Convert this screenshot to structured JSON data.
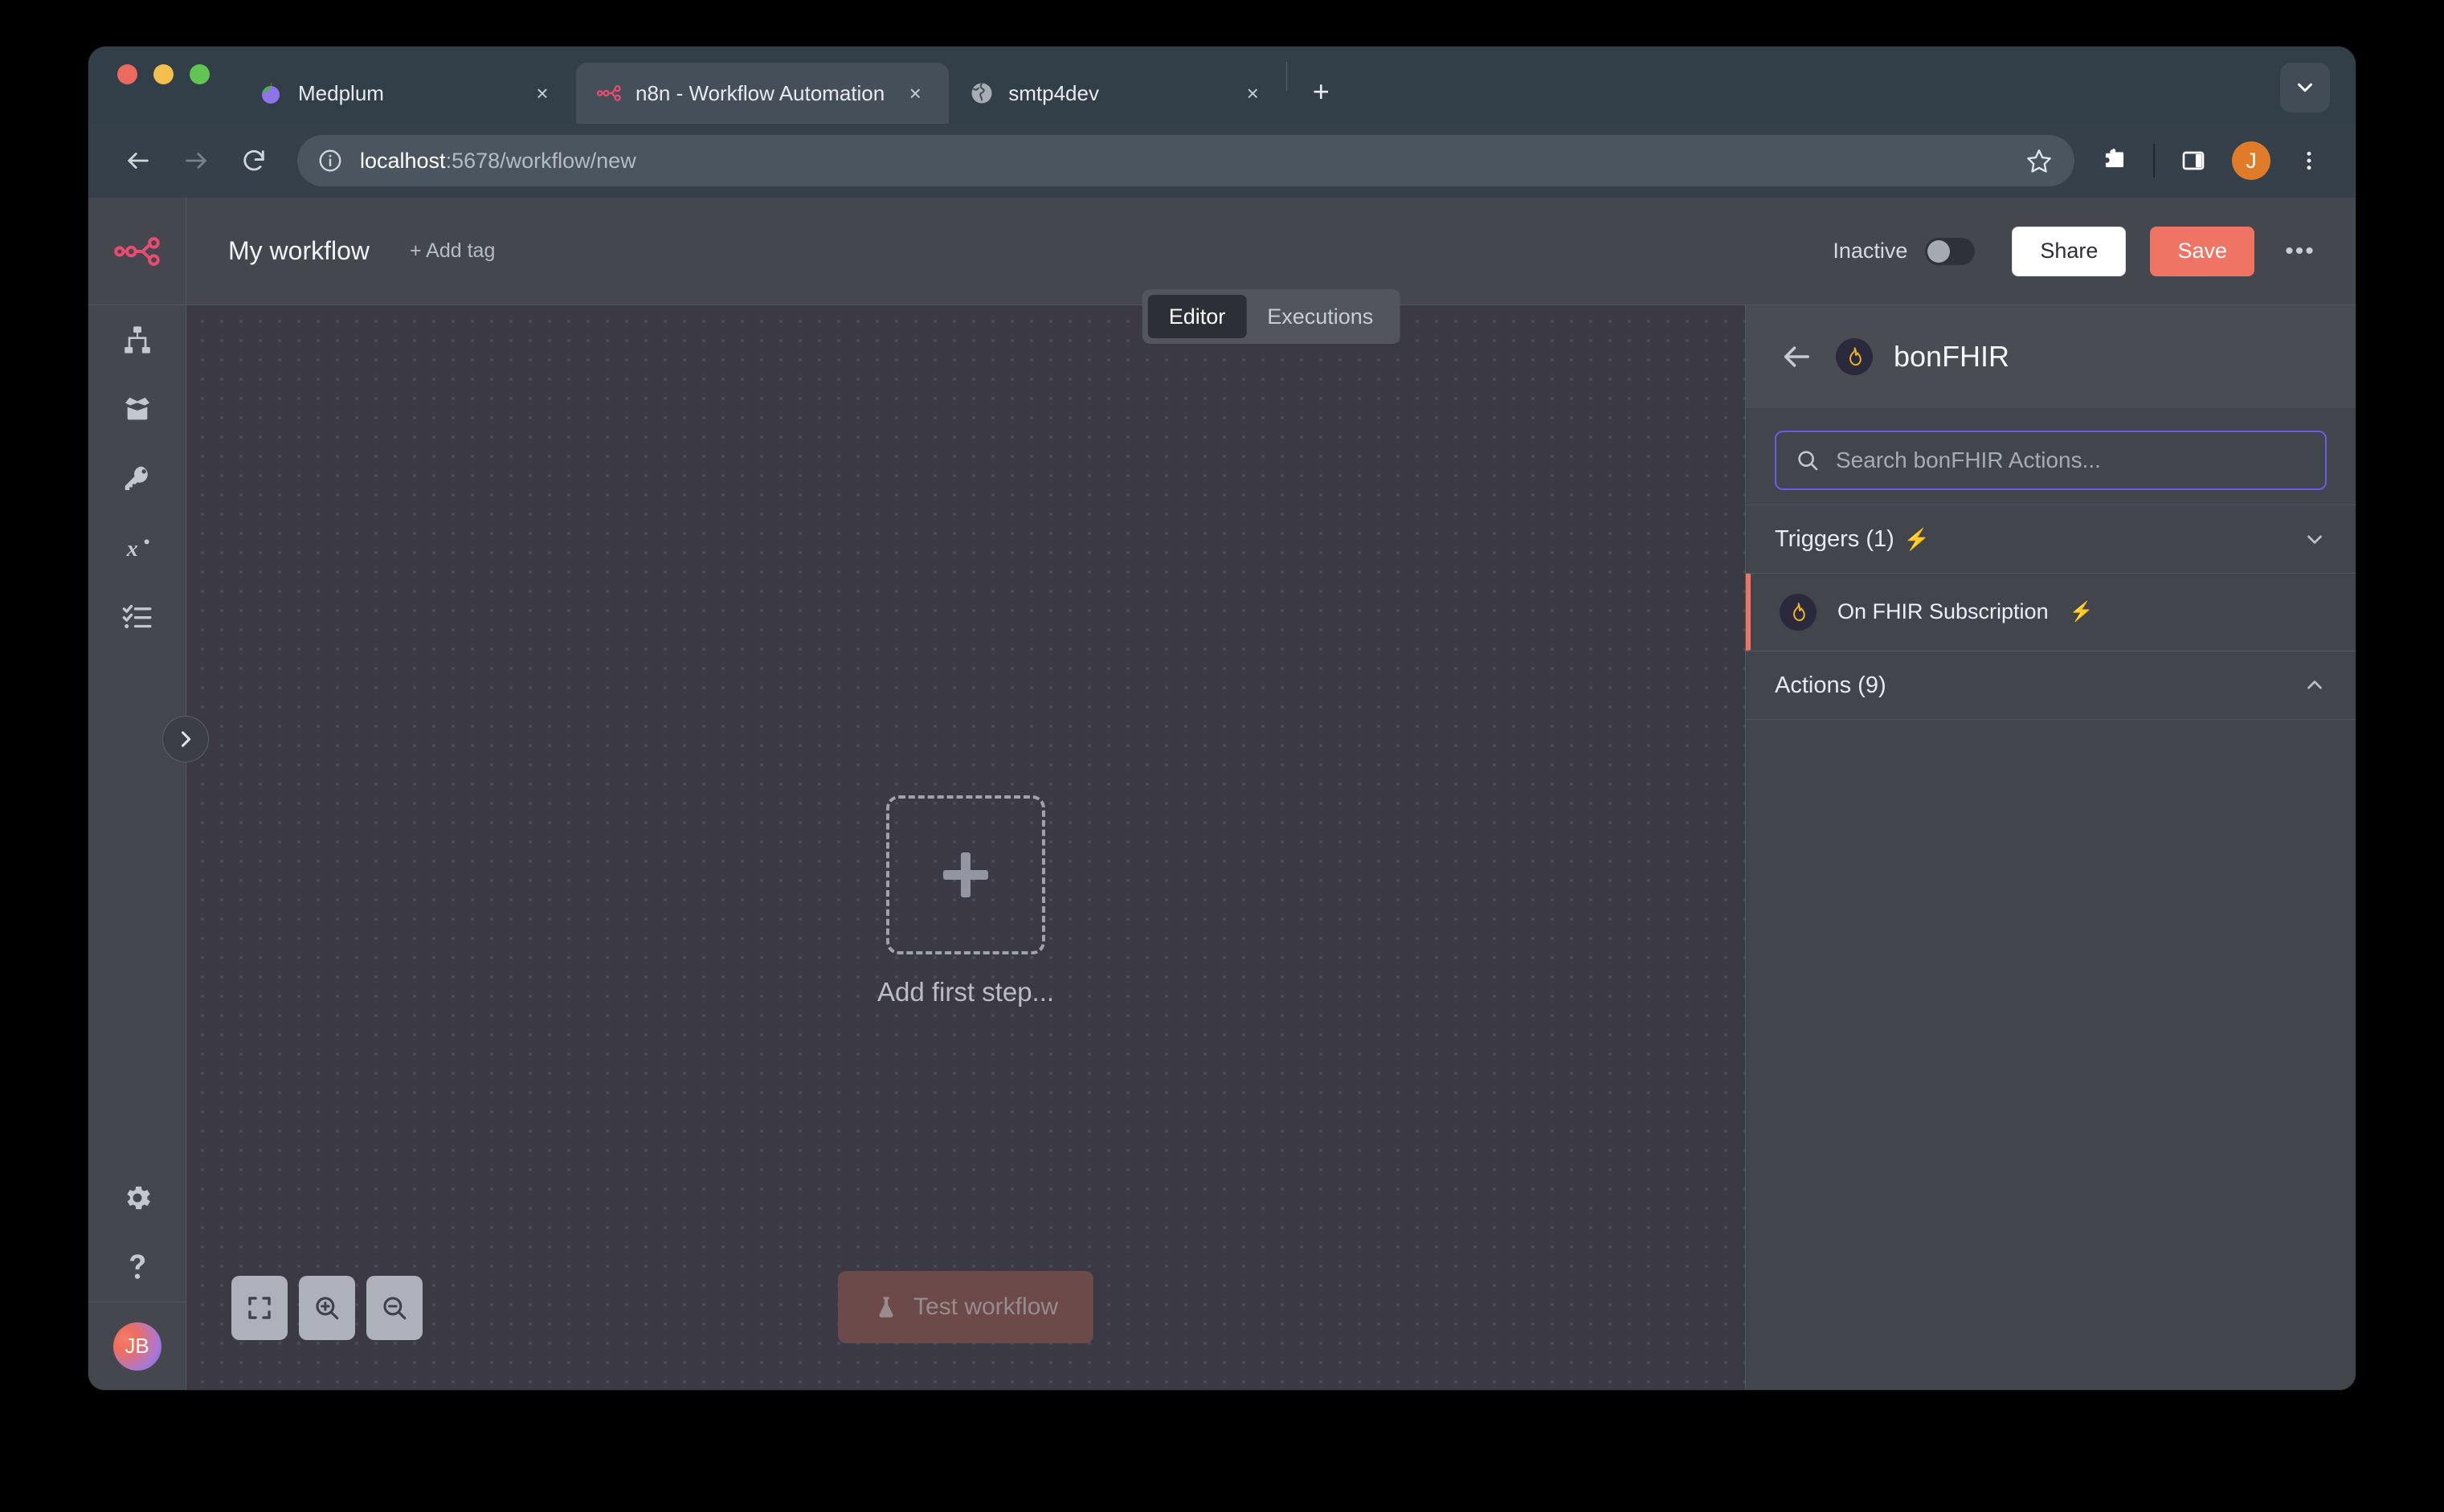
{
  "browser": {
    "tabs": [
      {
        "title": "Medplum",
        "favicon": "medplum-icon",
        "active": false,
        "close_label": "×"
      },
      {
        "title": "n8n - Workflow Automation",
        "favicon": "n8n-icon",
        "active": true,
        "close_label": "×"
      },
      {
        "title": "smtp4dev",
        "favicon": "globe-icon",
        "active": false,
        "close_label": "×"
      }
    ],
    "new_tab_label": "+",
    "tab_list_icon": "chevron-down-icon",
    "back_icon": "arrow-left-icon",
    "forward_icon": "arrow-right-icon",
    "reload_icon": "reload-icon",
    "site_info_icon": "info-circle-icon",
    "url_prefix": "localhost",
    "url_suffix": ":5678/workflow/new",
    "url_full": "localhost:5678/workflow/new",
    "bookmark_icon": "star-icon",
    "extensions_icon": "puzzle-icon",
    "side_panel_icon": "side-panel-icon",
    "profile_initial": "J",
    "menu_icon": "three-dots-vertical-icon"
  },
  "sidebar": {
    "logo": "n8n-logo",
    "items": [
      {
        "name": "overview",
        "icon": "sitemap-icon"
      },
      {
        "name": "templates",
        "icon": "open-box-icon"
      },
      {
        "name": "credentials",
        "icon": "key-icon"
      },
      {
        "name": "variables",
        "icon": "variable-x-icon"
      },
      {
        "name": "executions",
        "icon": "checklist-icon"
      }
    ],
    "bottom_items": [
      {
        "name": "settings",
        "icon": "gear-icon"
      },
      {
        "name": "help",
        "icon": "question-mark-icon"
      }
    ],
    "avatar_initials": "JB",
    "expander_icon": "chevron-right-icon"
  },
  "header": {
    "workflow_title": "My workflow",
    "add_tag_label": "+ Add tag",
    "active_state_label": "Inactive",
    "toggle_on": false,
    "share_label": "Share",
    "save_label": "Save",
    "more_label": "•••",
    "save_color": "#ef7464"
  },
  "view_tabs": [
    {
      "label": "Editor",
      "active": true
    },
    {
      "label": "Executions",
      "active": false
    }
  ],
  "canvas": {
    "add_first_step_label": "Add first step...",
    "plus_icon": "plus-icon",
    "controls": [
      {
        "name": "zoom-to-fit",
        "icon": "fit-screen-icon"
      },
      {
        "name": "zoom-in",
        "icon": "magnifier-plus-icon"
      },
      {
        "name": "zoom-out",
        "icon": "magnifier-minus-icon"
      }
    ],
    "test_workflow_label": "Test workflow",
    "test_workflow_icon": "flask-icon"
  },
  "nodes_panel": {
    "back_icon": "arrow-left-icon",
    "brand_icon": "bonfhir-flame-icon",
    "title": "bonFHIR",
    "search_placeholder": "Search bonFHIR Actions...",
    "search_value": "",
    "search_icon": "search-icon",
    "sections": [
      {
        "title": "Triggers (1)",
        "has_bolt": true,
        "expanded": true,
        "chevron": "chevron-down-icon",
        "items": [
          {
            "label": "On FHIR Subscription",
            "icon": "bonfhir-flame-icon",
            "has_bolt": true
          }
        ]
      },
      {
        "title": "Actions (9)",
        "has_bolt": false,
        "expanded": false,
        "chevron": "chevron-up-icon",
        "items": []
      }
    ]
  },
  "colors": {
    "accent": "#ef7464",
    "search_focus": "#6b5ce7",
    "canvas_bg": "#3b3944",
    "panel_bg": "#43454d",
    "chrome_bg": "#35404a"
  }
}
